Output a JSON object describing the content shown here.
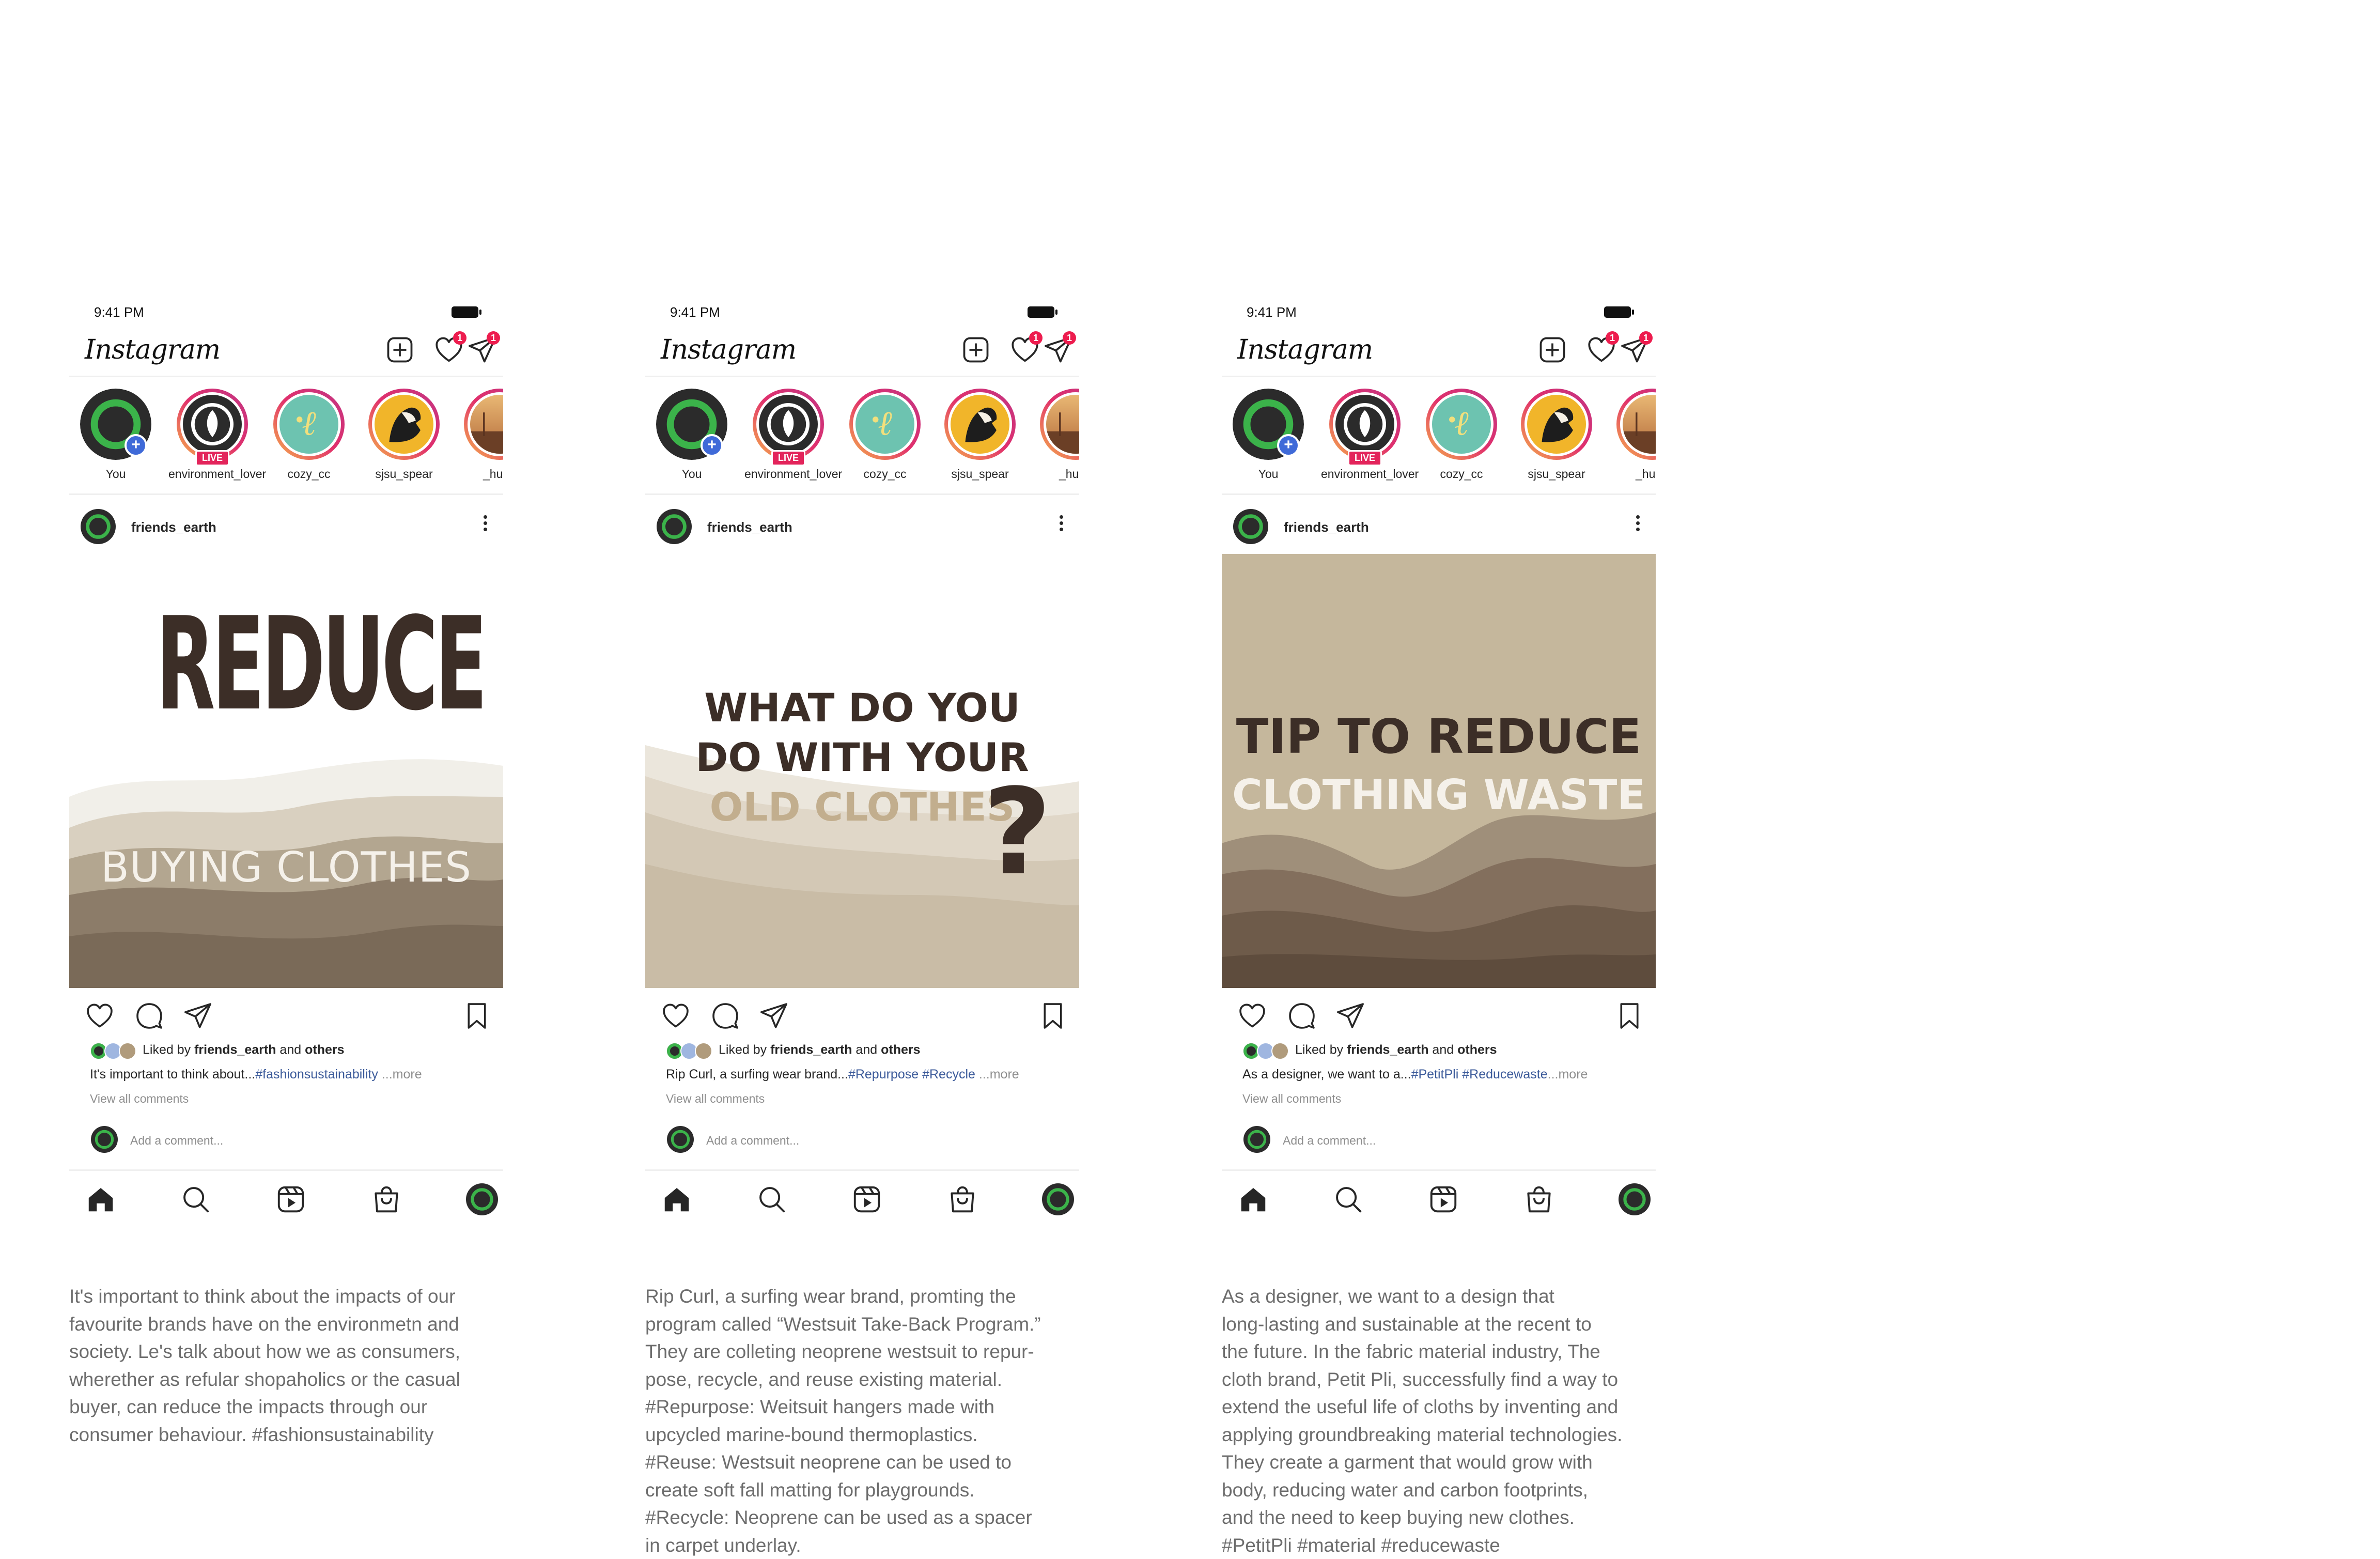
{
  "colors": {
    "brand_ring": "#2f9e44",
    "badge": "#ed1c4e",
    "hashtag": "#3b5a9a",
    "image_dark_text": "#3c2e27",
    "image_light_text": "#f5f1ea"
  },
  "status_bar": {
    "time": "9:41 PM"
  },
  "app": {
    "logo": "Instagram",
    "notification_badge": "1",
    "message_badge": "1"
  },
  "stories": [
    {
      "name": "You"
    },
    {
      "name": "environment_lover",
      "live_label": "LIVE"
    },
    {
      "name": "cozy_cc"
    },
    {
      "name": "sjsu_spear"
    },
    {
      "name": "_huon"
    }
  ],
  "posts": [
    {
      "username": "friends_earth",
      "image": {
        "line1": "REDUCE",
        "line2": "BUYING CLOTHES"
      },
      "liked_by": {
        "prefix": "Liked by",
        "user": "friends_earth",
        "and": "and",
        "others": "others"
      },
      "caption": {
        "text": "It's important to think about...",
        "tags": "#fashionsustainability",
        "more": "...more"
      },
      "view_all": "View all comments",
      "add_comment": "Add a comment...",
      "description": "It's important to think about the impacts of our\nfavourite brands have on the environmetn and\nsociety. Le's talk about how we as consumers,\nwherether as refular shopaholics or the casual\nbuyer, can reduce the impacts through our\nconsumer behaviour. #fashionsustainability"
    },
    {
      "username": "friends_earth",
      "image": {
        "line1": "WHAT DO YOU",
        "line2": "DO WITH YOUR",
        "line3": "OLD CLOTHES",
        "mark": "?"
      },
      "liked_by": {
        "prefix": "Liked by",
        "user": "friends_earth",
        "and": "and",
        "others": "others"
      },
      "caption": {
        "text": "Rip Curl, a surfing wear brand...",
        "tags": "#Repurpose #Recycle",
        "more": "...more"
      },
      "view_all": "View all comments",
      "add_comment": "Add a comment...",
      "description": "Rip Curl, a surfing wear brand, promting the\nprogram called “Westsuit Take-Back Program.”\nThey are colleting neoprene westsuit to repur-\npose, recycle, and reuse existing material.\n#Repurpose:  Weitsuit hangers made with\nupcycled marine-bound thermoplastics.\n#Reuse: Westsuit neoprene can be used to\ncreate soft fall matting for playgrounds.\n#Recycle: Neoprene can be used as a spacer\nin carpet underlay."
    },
    {
      "username": "friends_earth",
      "image": {
        "line1": "TIP TO REDUCE",
        "line2": "CLOTHING WASTE"
      },
      "liked_by": {
        "prefix": "Liked by",
        "user": "friends_earth",
        "and": "and",
        "others": "others"
      },
      "caption": {
        "text": "As a designer, we want to a...",
        "tags": "#PetitPli #Reducewaste",
        "more": "...more"
      },
      "view_all": "View all comments",
      "add_comment": "Add a comment...",
      "description": "As a designer, we want to a design that\nlong-lasting and sustainable at the recent to\nthe future. In the fabric material industry, The\ncloth brand, Petit Pli, successfully find a way to\nextend the useful life of cloths by inventing and\napplying groundbreaking material technologies.\nThey create a garment that would grow with\nbody, reducing water and carbon footprints,\nand the need to keep buying new clothes.\n#PetitPli #material #reducewaste"
    }
  ]
}
